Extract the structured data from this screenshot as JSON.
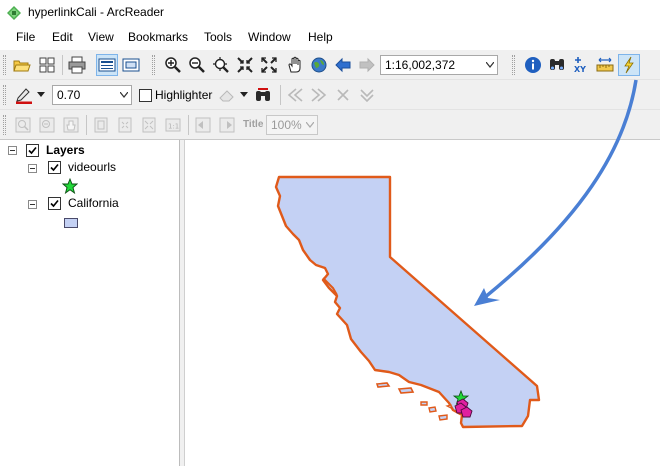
{
  "window": {
    "title": "hyperlinkCali - ArcReader"
  },
  "menu": [
    "File",
    "Edit",
    "View",
    "Bookmarks",
    "Tools",
    "Window",
    "Help"
  ],
  "toolbar_main": {
    "icons": [
      "open-icon",
      "document-layout-icon",
      "print-icon",
      "data-view-icon",
      "layout-view-icon",
      "zoom-in-icon",
      "zoom-out-icon",
      "fixed-zoom-in-icon",
      "fixed-zoom-out-icon",
      "full-extent-icon",
      "pan-icon",
      "globe-icon",
      "back-arrow-icon",
      "forward-arrow-icon",
      "identify-icon",
      "find-icon",
      "xy-icon",
      "measure-icon",
      "hyperlink-lightning-icon"
    ],
    "scale": "1:16,002,372"
  },
  "toolbar_draw": {
    "line_width": "0.70",
    "highlighter_label": "Highlighter"
  },
  "toolbar_layout": {
    "zoom_percent": "100%",
    "title_label": "Title"
  },
  "toc": {
    "root": "Layers",
    "layers": [
      {
        "name": "videourls",
        "symbol": "green-star-icon"
      },
      {
        "name": "California",
        "symbol": "lavender-fill-swatch"
      }
    ]
  },
  "colors": {
    "state_fill": "#c4d1f4",
    "state_outline": "#e05a1a",
    "point_fill": "#e020a0",
    "arrow": "#4a7fd4",
    "highlight_button": "#cce4f7"
  }
}
